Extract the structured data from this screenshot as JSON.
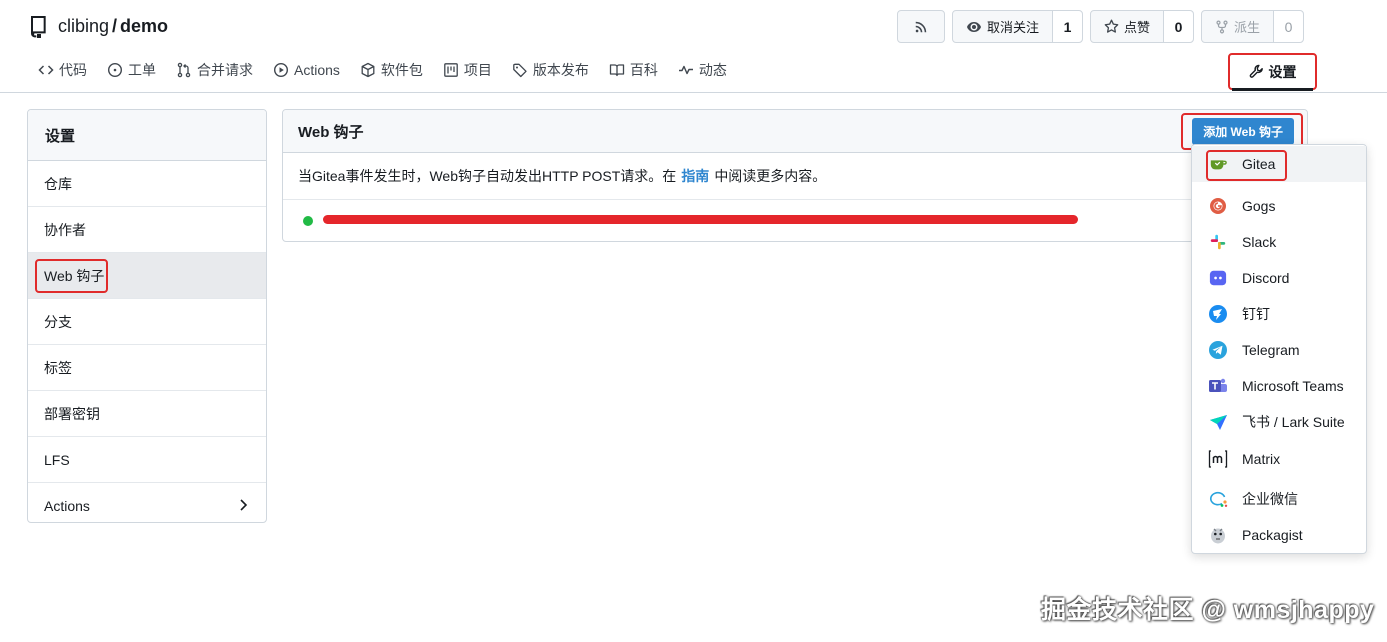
{
  "repo": {
    "owner": "clibing",
    "separator": "/",
    "name": "demo"
  },
  "header_buttons": {
    "unwatch_label": "取消关注",
    "watch_count": "1",
    "star_label": "点赞",
    "star_count": "0",
    "fork_label": "派生",
    "fork_count": "0"
  },
  "nav": {
    "items": [
      "代码",
      "工单",
      "合并请求",
      "Actions",
      "软件包",
      "项目",
      "版本发布",
      "百科",
      "动态"
    ],
    "settings": "设置"
  },
  "sidebar": {
    "title": "设置",
    "items": [
      "仓库",
      "协作者",
      "Web 钩子",
      "分支",
      "标签",
      "部署密钥",
      "LFS",
      "Actions"
    ]
  },
  "panel": {
    "title": "Web 钩子",
    "add_button": "添加 Web 钩子",
    "desc_before": "当Gitea事件发生时，Web钩子自动发出HTTP POST请求。在",
    "desc_link": "指南",
    "desc_after": "中阅读更多内容。"
  },
  "dropdown": {
    "items": [
      "Gitea",
      "Gogs",
      "Slack",
      "Discord",
      "钉钉",
      "Telegram",
      "Microsoft Teams",
      "飞书 / Lark Suite",
      "Matrix",
      "企业微信",
      "Packagist"
    ]
  },
  "watermark": "掘金技术社区 @ wmsjhappy",
  "colors": {
    "primary": "#2f86cf",
    "highlight": "#e02b2b",
    "status_ok": "#21ba45"
  }
}
